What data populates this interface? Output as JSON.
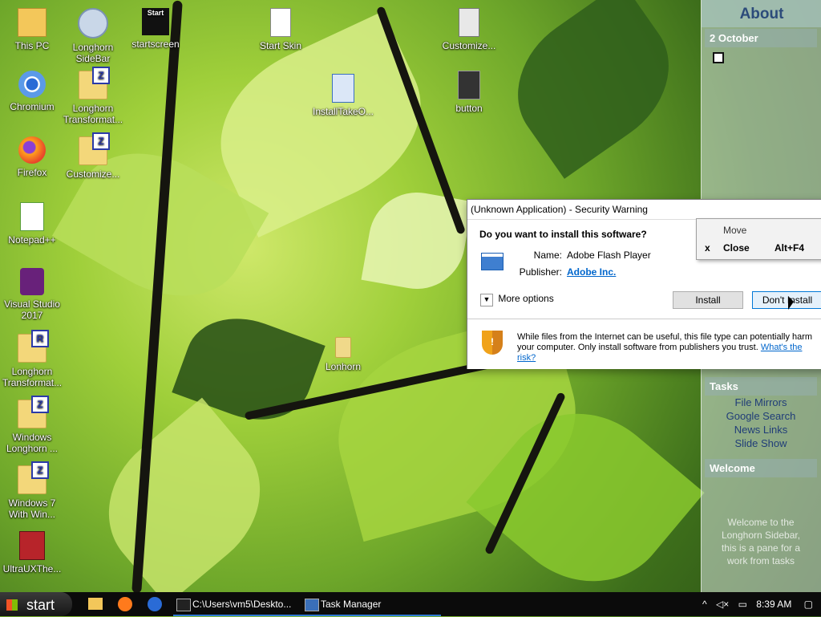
{
  "desktop": {
    "icons": [
      {
        "label": "This PC",
        "icon": "this-pc-icon"
      },
      {
        "label": "Longhorn SideBar",
        "icon": "longhorn-sidebar-icon"
      },
      {
        "label": "startscreen",
        "icon": "shortcut-icon",
        "overlay": "Start"
      },
      {
        "label": "Start Skin",
        "icon": "file-icon"
      },
      {
        "label": "Customize...",
        "icon": "settings-file-icon"
      },
      {
        "label": "Chromium",
        "icon": "chromium-icon"
      },
      {
        "label": "Longhorn Transformat...",
        "icon": "folder-icon",
        "badge": "Z"
      },
      {
        "label": "InstallTakeO...",
        "icon": "installer-icon"
      },
      {
        "label": "button",
        "icon": "button-icon"
      },
      {
        "label": "Firefox",
        "icon": "firefox-icon"
      },
      {
        "label": "Customize...",
        "icon": "folder-icon",
        "badge": "Z"
      },
      {
        "label": "Notepad++",
        "icon": "notepadpp-icon"
      },
      {
        "label": "Visual Studio 2017",
        "icon": "visual-studio-icon"
      },
      {
        "label": "Longhorn Transformat...",
        "icon": "folder-icon",
        "badge": "R"
      },
      {
        "label": "Lonhorn",
        "icon": "folder-icon"
      },
      {
        "label": "Windows Longhorn ...",
        "icon": "folder-icon",
        "badge": "Z"
      },
      {
        "label": "Windows 7 With Win...",
        "icon": "folder-icon",
        "badge": "Z"
      },
      {
        "label": "UltraUXThe...",
        "icon": "ultrauxtheme-icon"
      }
    ]
  },
  "sidebar": {
    "title": "About",
    "date": "2 October",
    "tasks_title": "Tasks",
    "tasks": [
      "File Mirrors",
      "Google Search",
      "News Links",
      "Slide Show"
    ],
    "welcome_title": "Welcome",
    "welcome_text": "Welcome to the Longhorn Sidebar, this is a pane for a work from tasks"
  },
  "dialog": {
    "title": "(Unknown Application) - Security Warning",
    "question": "Do you want to install this software?",
    "name_label": "Name:",
    "name_value": "Adobe Flash Player",
    "publisher_label": "Publisher:",
    "publisher_value": "Adobe Inc.",
    "more_options": "More options",
    "install_button": "Install",
    "dont_install_button": "Don't Install",
    "warning_text": "While files from the Internet can be useful, this file type can potentially harm your computer. Only install software from publishers you trust.",
    "risk_link": "What's the risk?"
  },
  "context_menu": {
    "items": [
      {
        "label": "Move",
        "prefix": "",
        "shortcut": ""
      },
      {
        "label": "Close",
        "prefix": "x",
        "shortcut": "Alt+F4"
      }
    ]
  },
  "taskbar": {
    "start_label": "start",
    "tasks": [
      {
        "label": "C:\\Users\\vm5\\Deskto...",
        "icon": "cmd-icon"
      },
      {
        "label": "Task Manager",
        "icon": "task-manager-icon"
      }
    ],
    "time": "8:39 AM",
    "colors": {
      "bg": "#0b0b0b",
      "accent": "#0078d7"
    }
  }
}
